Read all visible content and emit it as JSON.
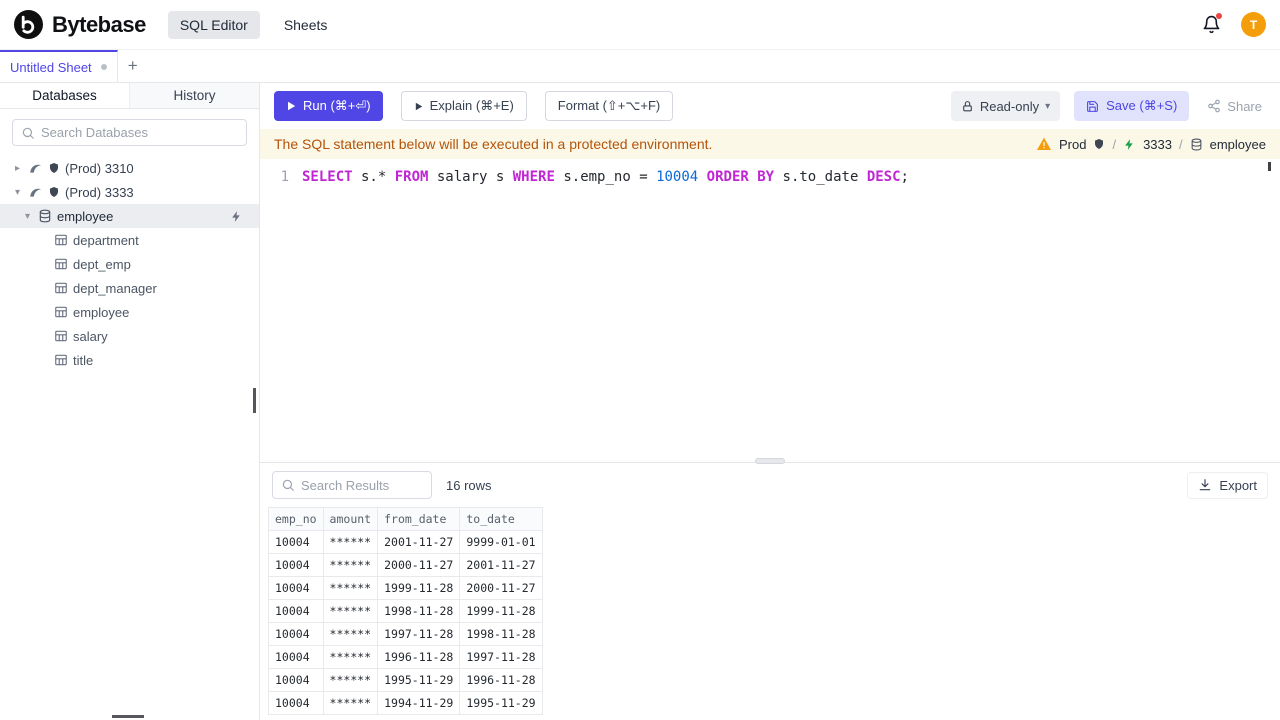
{
  "topbar": {
    "brand": "Bytebase",
    "tabs": [
      {
        "label": "SQL Editor",
        "active": true
      },
      {
        "label": "Sheets",
        "active": false
      }
    ],
    "avatar_initial": "T"
  },
  "sheet_tabs": {
    "active_tab": "Untitled Sheet",
    "add_button": "+"
  },
  "sidebar": {
    "tabs": [
      {
        "label": "Databases",
        "active": true
      },
      {
        "label": "History",
        "active": false
      }
    ],
    "search_placeholder": "Search Databases",
    "tree": {
      "instances": [
        {
          "label": "(Prod) 3310",
          "expanded": false
        },
        {
          "label": "(Prod) 3333",
          "expanded": true
        }
      ],
      "database": {
        "label": "employee",
        "selected": true
      },
      "tables": [
        "department",
        "dept_emp",
        "dept_manager",
        "employee",
        "salary",
        "title"
      ]
    }
  },
  "toolbar": {
    "run": "Run (⌘+⏎)",
    "explain": "Explain (⌘+E)",
    "format": "Format (⇧+⌥+F)",
    "readonly": "Read-only",
    "save": "Save (⌘+S)",
    "share": "Share"
  },
  "banner": {
    "message": "The SQL statement below will be executed in a protected environment.",
    "environment": "Prod",
    "separator": "/",
    "instance": "3333",
    "database": "employee"
  },
  "editor": {
    "line_number": "1",
    "sql": "SELECT s.* FROM salary s WHERE s.emp_no = 10004 ORDER BY s.to_date DESC;",
    "tokens": [
      {
        "text": "SELECT",
        "type": "kw"
      },
      {
        "text": " s.* ",
        "type": "plain"
      },
      {
        "text": "FROM",
        "type": "kw"
      },
      {
        "text": " salary s ",
        "type": "plain"
      },
      {
        "text": "WHERE",
        "type": "kw"
      },
      {
        "text": " s.emp_no = ",
        "type": "plain"
      },
      {
        "text": "10004",
        "type": "num"
      },
      {
        "text": " ",
        "type": "plain"
      },
      {
        "text": "ORDER BY",
        "type": "kw"
      },
      {
        "text": " s.to_date ",
        "type": "plain"
      },
      {
        "text": "DESC",
        "type": "kw"
      },
      {
        "text": ";",
        "type": "plain"
      }
    ]
  },
  "results": {
    "search_placeholder": "Search Results",
    "row_count": "16 rows",
    "export": "Export",
    "columns": [
      "emp_no",
      "amount",
      "from_date",
      "to_date"
    ],
    "rows": [
      [
        "10004",
        "******",
        "2001-11-27",
        "9999-01-01"
      ],
      [
        "10004",
        "******",
        "2000-11-27",
        "2001-11-27"
      ],
      [
        "10004",
        "******",
        "1999-11-28",
        "2000-11-27"
      ],
      [
        "10004",
        "******",
        "1998-11-28",
        "1999-11-28"
      ],
      [
        "10004",
        "******",
        "1997-11-28",
        "1998-11-28"
      ],
      [
        "10004",
        "******",
        "1996-11-28",
        "1997-11-28"
      ],
      [
        "10004",
        "******",
        "1995-11-29",
        "1996-11-28"
      ],
      [
        "10004",
        "******",
        "1994-11-29",
        "1995-11-29"
      ]
    ]
  },
  "colors": {
    "accent": "#4f46e5",
    "warning_bg": "#fcf8e7",
    "warning_text": "#b45309",
    "avatar_bg": "#f59e0b",
    "keyword": "#c026d3",
    "number": "#0969da",
    "env_zap_green": "#16a34a",
    "notification_dot": "#ef4444"
  }
}
